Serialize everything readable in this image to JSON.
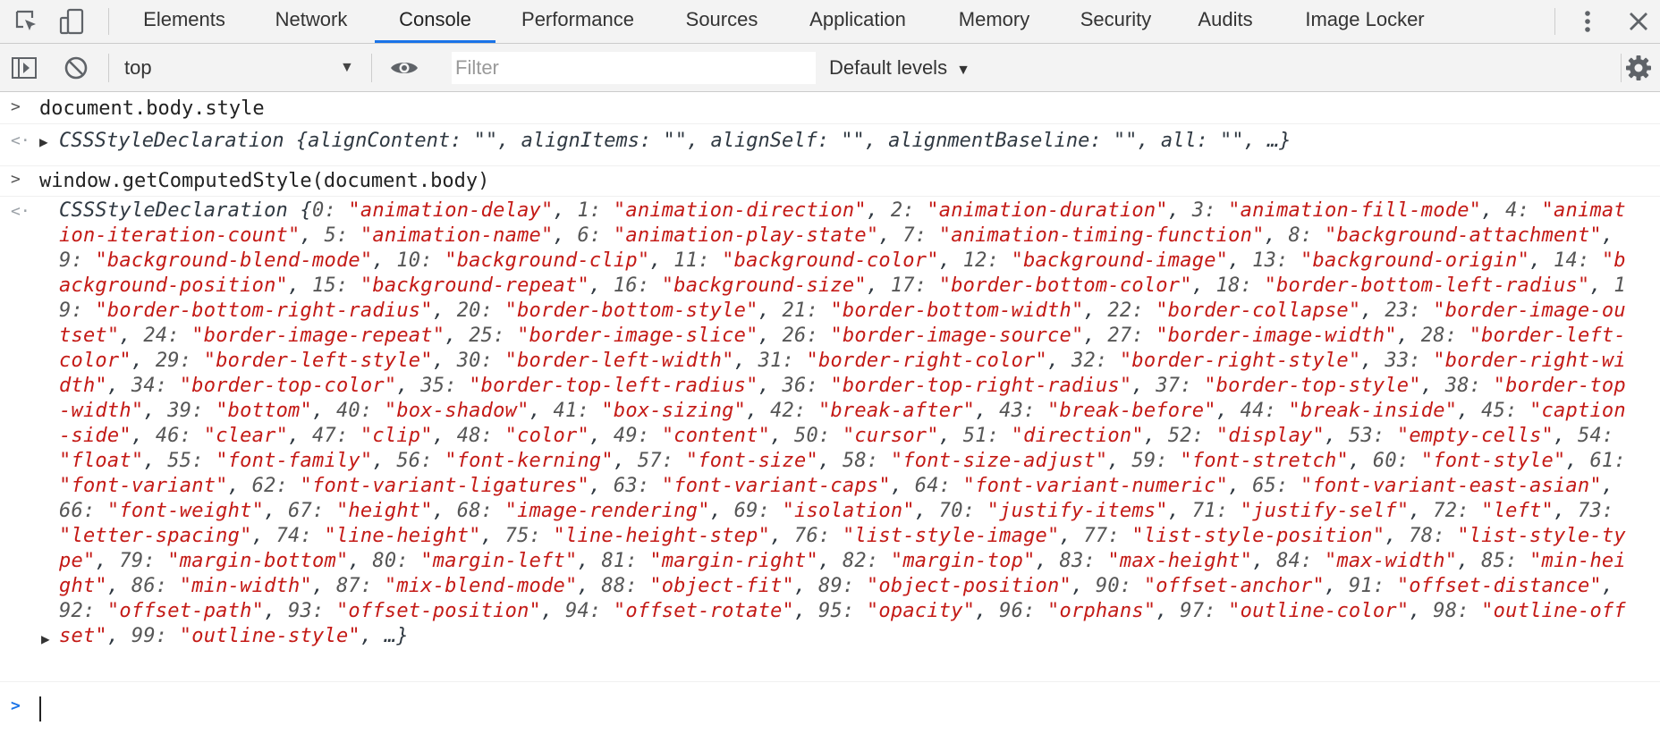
{
  "tabs": {
    "items": [
      {
        "label": "Elements"
      },
      {
        "label": "Network"
      },
      {
        "label": "Console",
        "active": true
      },
      {
        "label": "Performance"
      },
      {
        "label": "Sources"
      },
      {
        "label": "Application"
      },
      {
        "label": "Memory"
      },
      {
        "label": "Security"
      },
      {
        "label": "Audits"
      },
      {
        "label": "Image Locker"
      }
    ],
    "accent": "#1a73e8"
  },
  "toolbar": {
    "context": "top",
    "filter_placeholder": "Filter",
    "levels": "Default levels"
  },
  "console": {
    "cmd1": "document.body.style",
    "result1": {
      "type": "CSSStyleDeclaration",
      "preview": "{alignContent: \"\", alignItems: \"\", alignSelf: \"\", alignmentBaseline: \"\", all: \"\", …}"
    },
    "cmd2": "window.getComputedStyle(document.body)",
    "result2": {
      "type": "CSSStyleDeclaration",
      "entries": [
        "animation-delay",
        "animation-direction",
        "animation-duration",
        "animation-fill-mode",
        "animation-iteration-count",
        "animation-name",
        "animation-play-state",
        "animation-timing-function",
        "background-attachment",
        "background-blend-mode",
        "background-clip",
        "background-color",
        "background-image",
        "background-origin",
        "background-position",
        "background-repeat",
        "background-size",
        "border-bottom-color",
        "border-bottom-left-radius",
        "border-bottom-right-radius",
        "border-bottom-style",
        "border-bottom-width",
        "border-collapse",
        "border-image-outset",
        "border-image-repeat",
        "border-image-slice",
        "border-image-source",
        "border-image-width",
        "border-left-color",
        "border-left-style",
        "border-left-width",
        "border-right-color",
        "border-right-style",
        "border-right-width",
        "border-top-color",
        "border-top-left-radius",
        "border-top-right-radius",
        "border-top-style",
        "border-top-width",
        "bottom",
        "box-shadow",
        "box-sizing",
        "break-after",
        "break-before",
        "break-inside",
        "caption-side",
        "clear",
        "clip",
        "color",
        "content",
        "cursor",
        "direction",
        "display",
        "empty-cells",
        "float",
        "font-family",
        "font-kerning",
        "font-size",
        "font-size-adjust",
        "font-stretch",
        "font-style",
        "font-variant",
        "font-variant-ligatures",
        "font-variant-caps",
        "font-variant-numeric",
        "font-variant-east-asian",
        "font-weight",
        "height",
        "image-rendering",
        "isolation",
        "justify-items",
        "justify-self",
        "left",
        "letter-spacing",
        "line-height",
        "line-height-step",
        "list-style-image",
        "list-style-position",
        "list-style-type",
        "margin-bottom",
        "margin-left",
        "margin-right",
        "margin-top",
        "max-height",
        "max-width",
        "min-height",
        "min-width",
        "mix-blend-mode",
        "object-fit",
        "object-position",
        "offset-anchor",
        "offset-distance",
        "offset-path",
        "offset-position",
        "offset-rotate",
        "opacity",
        "orphans",
        "outline-color",
        "outline-offset",
        "outline-style"
      ],
      "ellipsis": "…}"
    },
    "string_color": "#c41a16"
  }
}
